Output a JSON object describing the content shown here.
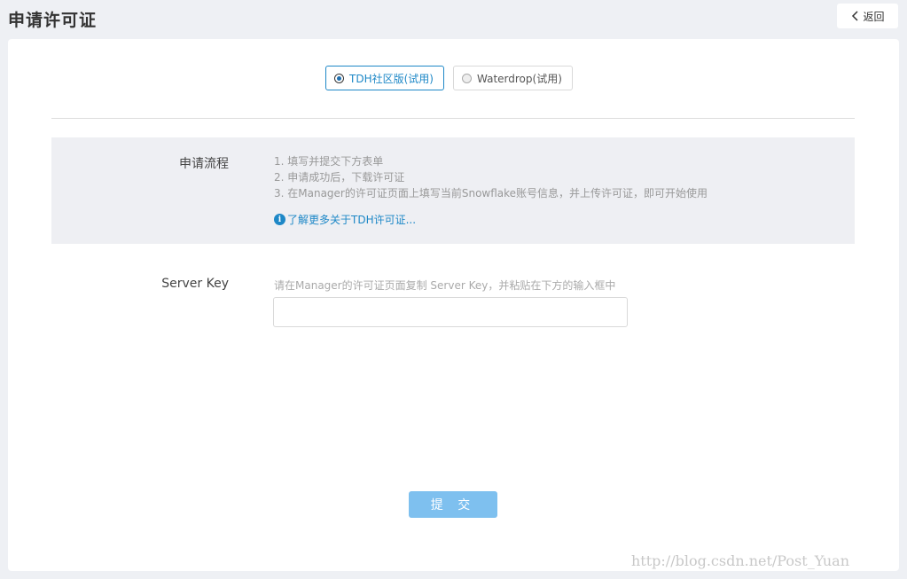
{
  "header": {
    "title": "申请许可证",
    "back_label": "返回"
  },
  "editions": [
    {
      "label": "TDH社区版(试用)",
      "selected": true
    },
    {
      "label": "Waterdrop(试用)",
      "selected": false
    }
  ],
  "process": {
    "label": "申请流程",
    "steps": [
      "1. 填写并提交下方表单",
      "2. 申请成功后，下载许可证",
      "3. 在Manager的许可证页面上填写当前Snowflake账号信息，并上传许可证，即可开始使用"
    ],
    "learn_more": "了解更多关于TDH许可证..."
  },
  "server_key": {
    "label": "Server Key",
    "hint": "请在Manager的许可证页面复制 Server Key，并粘贴在下方的输入框中",
    "value": ""
  },
  "submit_label": "提 交",
  "watermark": "http://blog.csdn.net/Post_Yuan",
  "colors": {
    "accent": "#1e88c7",
    "submit_bg": "#7ec0ef",
    "page_bg": "#eef0f4"
  }
}
